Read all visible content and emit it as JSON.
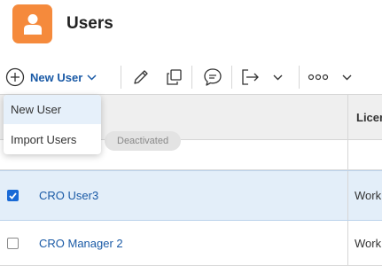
{
  "header": {
    "title": "Users",
    "icon": "user-icon",
    "icon_color": "#f58a3c"
  },
  "toolbar": {
    "new_user_label": "New User",
    "accent_color": "#1a5aa6",
    "icons": [
      "plus-circle-icon",
      "chevron-down-icon",
      "edit-icon",
      "copy-icon",
      "message-icon",
      "export-icon",
      "chevron-down-icon",
      "more-icon",
      "chevron-down-icon"
    ]
  },
  "dropdown": {
    "items": [
      {
        "label": "New User"
      },
      {
        "label": "Import Users"
      }
    ]
  },
  "table": {
    "columns": {
      "license": "Licen"
    },
    "partial_row": {
      "status_badge": "Deactivated"
    },
    "rows": [
      {
        "name": "CRO User3",
        "license": "Work",
        "checked": true
      },
      {
        "name": "CRO Manager 2",
        "license": "Work",
        "checked": false
      }
    ]
  }
}
